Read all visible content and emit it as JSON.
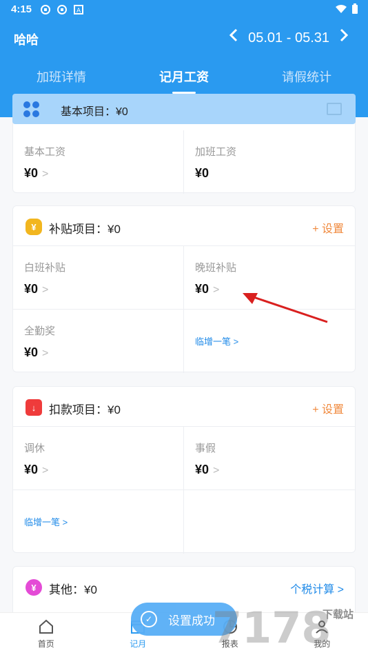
{
  "status": {
    "time": "4:15"
  },
  "header": {
    "title": "哈哈",
    "date_range": "05.01 - 05.31",
    "prev_icon": "chevron-left-icon",
    "next_icon": "chevron-right-icon"
  },
  "tabs": [
    {
      "label": "加班详情",
      "active": false
    },
    {
      "label": "记月工资",
      "active": true
    },
    {
      "label": "请假统计",
      "active": false
    }
  ],
  "base": {
    "label": "基本项目：¥0",
    "cells": [
      {
        "label": "基本工资",
        "value": "¥0"
      },
      {
        "label": "加班工资",
        "value": "¥0"
      }
    ]
  },
  "subsidy": {
    "title": "补贴项目：¥0",
    "action": "+ 设置",
    "cells": [
      {
        "label": "白班补贴",
        "value": "¥0"
      },
      {
        "label": "晚班补贴",
        "value": "¥0"
      },
      {
        "label": "全勤奖",
        "value": "¥0"
      }
    ],
    "add_link": "临增一笔 >"
  },
  "deduction": {
    "title": "扣款项目：¥0",
    "action": "+ 设置",
    "cells": [
      {
        "label": "调休",
        "value": "¥0"
      },
      {
        "label": "事假",
        "value": "¥0"
      }
    ],
    "add_link": "临增一笔 >"
  },
  "other": {
    "title": "其他：¥0",
    "action": "个税计算 >"
  },
  "toast": {
    "text": "设置成功"
  },
  "bottom_nav": [
    {
      "label": "首页",
      "icon": "home-icon",
      "active": false
    },
    {
      "label": "记月",
      "icon": "calendar-icon",
      "active": true
    },
    {
      "label": "报表",
      "icon": "chart-icon",
      "active": false
    },
    {
      "label": "我的",
      "icon": "user-icon",
      "active": false
    }
  ],
  "watermark": "7178 下载站",
  "colors": {
    "primary": "#2a9af0",
    "orange": "#f08a3e",
    "link": "#1f8ae8",
    "annotation": "#d9201f"
  }
}
